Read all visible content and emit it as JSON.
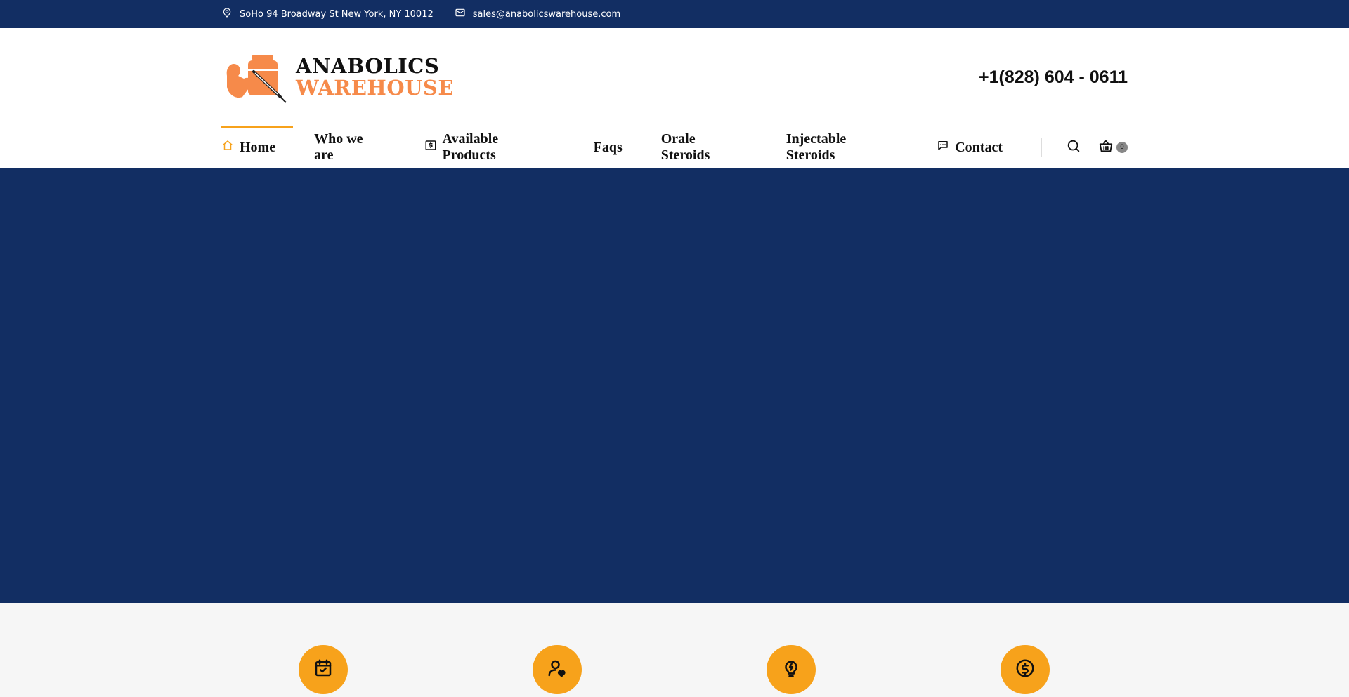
{
  "topbar": {
    "address": "SoHo 94 Broadway St New York, NY 10012",
    "address_icon": "location-pin-icon",
    "email": "sales@anabolicswarehouse.com",
    "email_icon": "mail-icon"
  },
  "header": {
    "logo_line1": "ANABOLICS",
    "logo_line2": "WAREHOUSE",
    "phone": "+1(828) 604 - 0611"
  },
  "nav": {
    "items": [
      {
        "label": "Home",
        "icon": "home-icon",
        "active": true
      },
      {
        "label": "Who we are"
      },
      {
        "label": "Available Products",
        "icon": "dollar-box-icon"
      },
      {
        "label": "Faqs"
      },
      {
        "label": "Orale Steroids"
      },
      {
        "label": "Injectable Steroids"
      },
      {
        "label": "Contact",
        "icon": "chat-icon"
      }
    ],
    "cart_count": "0"
  },
  "features": {
    "icons": [
      "calendar-check-icon",
      "user-heart-icon",
      "bulb-bolt-icon",
      "dollar-coin-icon"
    ]
  },
  "colors": {
    "primary": "#122e63",
    "accent": "#f7a21b",
    "logo_orange": "#f68a4a"
  }
}
